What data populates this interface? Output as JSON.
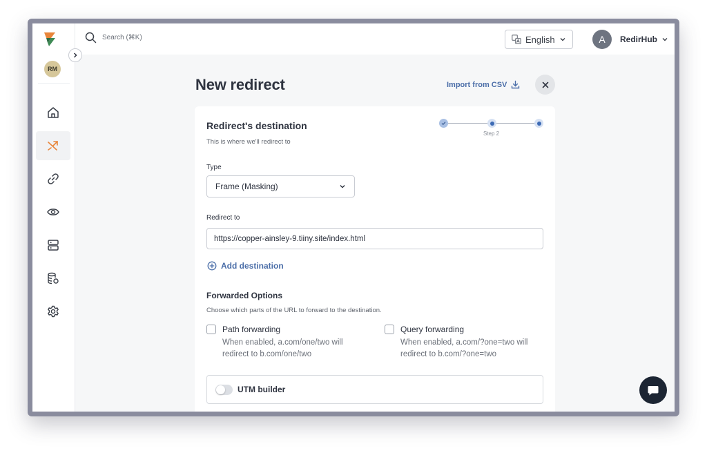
{
  "sidebar": {
    "workspace_initials": "RM",
    "items": [
      {
        "name": "home",
        "icon": "home-icon"
      },
      {
        "name": "redirects",
        "icon": "shuffle-icon",
        "active": true
      },
      {
        "name": "links",
        "icon": "link-icon"
      },
      {
        "name": "monitoring",
        "icon": "eye-icon"
      },
      {
        "name": "servers",
        "icon": "server-icon"
      },
      {
        "name": "database",
        "icon": "database-icon"
      },
      {
        "name": "settings",
        "icon": "gear-icon"
      }
    ]
  },
  "header": {
    "search_placeholder": "Search (⌘K)",
    "language": "English",
    "user_initial": "A",
    "user_name": "RedirHub"
  },
  "page": {
    "title": "New redirect",
    "import_label": "Import from CSV"
  },
  "card": {
    "title": "Redirect's destination",
    "subtitle": "This is where we'll redirect to",
    "stepper": {
      "current_label": "Step 2",
      "current": 2,
      "total": 3
    },
    "type_label": "Type",
    "type_value": "Frame (Masking)",
    "redirect_to_label": "Redirect to",
    "redirect_to_value": "https://copper-ainsley-9.tiiny.site/index.html",
    "add_destination": "Add destination",
    "forwarded": {
      "title": "Forwarded Options",
      "subtitle": "Choose which parts of the URL to forward to the destination.",
      "path": {
        "title": "Path forwarding",
        "description": "When enabled, a.com/one/two will redirect to b.com/one/two",
        "checked": false
      },
      "query": {
        "title": "Query forwarding",
        "description": "When enabled, a.com/?one=two will redirect to b.com/?one=two",
        "checked": false
      }
    },
    "utm": {
      "label": "UTM builder",
      "enabled": false
    }
  },
  "colors": {
    "accent": "#4b6ea8",
    "active_nav_icon": "#e8853a",
    "chat_button": "#1c2533"
  }
}
